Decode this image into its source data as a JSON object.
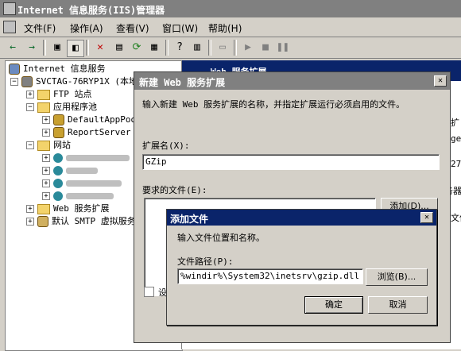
{
  "app": {
    "title": "Internet 信息服务(IIS)管理器"
  },
  "menu": [
    "文件(F)",
    "操作(A)",
    "查看(V)",
    "窗口(W)",
    "帮助(H)"
  ],
  "toolbar": {
    "back_icon": "back-arrow-icon",
    "forward_icon": "forward-arrow-icon"
  },
  "tree": {
    "root": "Internet 信息服务",
    "server": "SVCTAG-76RYP1X (本地计",
    "ftp": "FTP 站点",
    "apppools": "应用程序池",
    "pool1": "DefaultAppPool",
    "pool2": "ReportServer",
    "websites": "网站",
    "webext": "Web 服务扩展",
    "smtp": "默认 SMTP 虚拟服务"
  },
  "right": {
    "header": "Web 服务扩展",
    "frag1": "扩",
    "frag2": "ges",
    "frag3": "27",
    "frag4": "务器",
    "frag5": "文件"
  },
  "dialog1": {
    "title": "新建 Web 服务扩展",
    "instruction": "输入新建 Web 服务扩展的名称，并指定扩展运行必须启用的文件。",
    "name_label": "扩展名(X):",
    "name_value": "GZip",
    "files_label": "要求的文件(E):",
    "add_button": "添加(D)...",
    "checkbox_label": "设"
  },
  "dialog2": {
    "title": "添加文件",
    "instruction": "输入文件位置和名称。",
    "path_label": "文件路径(P):",
    "path_value": "%windir%\\System32\\inetsrv\\gzip.dll",
    "browse_button": "浏览(B)...",
    "ok_button": "确定",
    "cancel_button": "取消"
  }
}
